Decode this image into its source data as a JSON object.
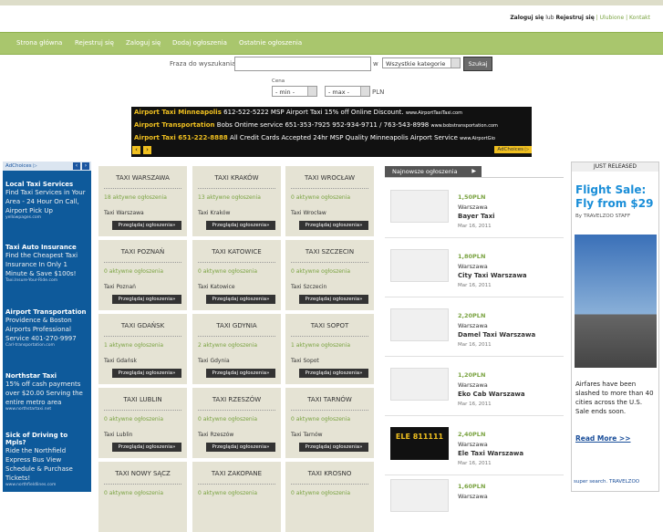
{
  "header": {
    "login_label": "Zaloguj się",
    "or": "lub",
    "register_label": "Rejestruj się",
    "favourites": "Ulubione",
    "contact": "Kontakt"
  },
  "nav": [
    "Strona główna",
    "Rejestruj się",
    "Zaloguj się",
    "Dodaj ogłoszenia",
    "Ostatnie ogłoszenia"
  ],
  "search": {
    "phrase_label": "Fraza do wyszukania",
    "in_label": "w",
    "category": "Wszystkie kategorie",
    "button": "Szukaj",
    "price_label": "Cena",
    "min": "- min -",
    "max": "- max -",
    "currency": "PLN"
  },
  "top_ad": {
    "rows": [
      {
        "title": "Airport Taxi Minneapolis",
        "text": "612-522-5222 MSP Airport Taxi 15% off Online Discount.",
        "url": "www.AirportTaxiTaxi.com"
      },
      {
        "title": "Airport Transportation",
        "text": "Bobs Ontime service 651-353-7925 952-934-9711 / 763-543-8998",
        "url": "www.bobstransportation.com"
      },
      {
        "title": "Airport Taxi 651-222-8888",
        "text": "All Credit Cards Accepted 24hr MSP Quality Minneapolis Airport Service",
        "url": "www.AirportGio"
      }
    ],
    "adchoices": "AdChoices ▷"
  },
  "left_ad": {
    "adchoices": "AdChoices ▷",
    "items": [
      {
        "title": "Local Taxi Services",
        "desc": "Find Taxi Services in Your Area - 24 Hour On Call, Airport Pick Up",
        "url": "yellowpages.com"
      },
      {
        "title": "Taxi Auto Insurance",
        "desc": "Find the Cheapest Taxi Insurance In Only 1 Minute & Save $100s!",
        "url": "Taxi.Insure-Your-Ride.com"
      },
      {
        "title": "Airport Transportation",
        "desc": "Providence & Boston Airports Professional Service 401-270-9997",
        "url": "Carl-transportation.com"
      },
      {
        "title": "Northstar Taxi",
        "desc": "15% off cash payments over $20.00 Serving the entire metro area",
        "url": "www.northstartaxi.net"
      },
      {
        "title": "Sick of Driving to Mpls?",
        "desc": "Ride the Northfield Express Bus View Schedule & Purchase Tickets!",
        "url": "www.northfieldlines.com"
      }
    ]
  },
  "categories": [
    {
      "title": "TAXI WARSZAWA",
      "count": "18 aktywne ogłoszenia",
      "city": "Taxi Warszawa",
      "button": "Przeglądaj ogłoszenia»"
    },
    {
      "title": "TAXI KRAKÓW",
      "count": "13 aktywne ogłoszenia",
      "city": "Taxi Kraków",
      "button": "Przeglądaj ogłoszenia»"
    },
    {
      "title": "TAXI WROCŁAW",
      "count": "0 aktywne ogłoszenia",
      "city": "Taxi Wrocław",
      "button": "Przeglądaj ogłoszenia»"
    },
    {
      "title": "TAXI POZNAŃ",
      "count": "0 aktywne ogłoszenia",
      "city": "Taxi Poznań",
      "button": "Przeglądaj ogłoszenia»"
    },
    {
      "title": "TAXI KATOWICE",
      "count": "0 aktywne ogłoszenia",
      "city": "Taxi Katowice",
      "button": "Przeglądaj ogłoszenia»"
    },
    {
      "title": "TAXI SZCZECIN",
      "count": "0 aktywne ogłoszenia",
      "city": "Taxi Szczecin",
      "button": "Przeglądaj ogłoszenia»"
    },
    {
      "title": "TAXI GDAŃSK",
      "count": "1 aktywne ogłoszenia",
      "city": "Taxi Gdańsk",
      "button": "Przeglądaj ogłoszenia»"
    },
    {
      "title": "TAXI GDYNIA",
      "count": "2 aktywne ogłoszenia",
      "city": "Taxi Gdynia",
      "button": "Przeglądaj ogłoszenia»"
    },
    {
      "title": "TAXI SOPOT",
      "count": "1 aktywne ogłoszenia",
      "city": "Taxi Sopot",
      "button": "Przeglądaj ogłoszenia»"
    },
    {
      "title": "TAXI LUBLIN",
      "count": "0 aktywne ogłoszenia",
      "city": "Taxi Lublin",
      "button": "Przeglądaj ogłoszenia»"
    },
    {
      "title": "TAXI RZESZÓW",
      "count": "0 aktywne ogłoszenia",
      "city": "Taxi Rzeszów",
      "button": "Przeglądaj ogłoszenia»"
    },
    {
      "title": "TAXI TARNÓW",
      "count": "0 aktywne ogłoszenia",
      "city": "Taxi Tarnów",
      "button": "Przeglądaj ogłoszenia»"
    },
    {
      "title": "TAXI NOWY SĄCZ",
      "count": "0 aktywne ogłoszenia",
      "city": "",
      "button": ""
    },
    {
      "title": "TAXI ZAKOPANE",
      "count": "0 aktywne ogłoszenia",
      "city": "",
      "button": ""
    },
    {
      "title": "TAXI KROSNO",
      "count": "0 aktywne ogłoszenia",
      "city": "",
      "button": ""
    }
  ],
  "latest": {
    "header": "Najnowsze ogłoszenia",
    "items": [
      {
        "price": "1,50PLN",
        "city": "Warszawa",
        "name": "Bayer Taxi",
        "date": "Mar 16, 2011"
      },
      {
        "price": "1,80PLN",
        "city": "Warszawa",
        "name": "City Taxi Warszawa",
        "date": "Mar 16, 2011"
      },
      {
        "price": "2,20PLN",
        "city": "Warszawa",
        "name": "Damel Taxi Warszawa",
        "date": "Mar 16, 2011"
      },
      {
        "price": "1,20PLN",
        "city": "Warszawa",
        "name": "Eko Cab Warszawa",
        "date": "Mar 16, 2011"
      },
      {
        "price": "2,40PLN",
        "city": "Warszawa",
        "name": "Ele Taxi Warszawa",
        "date": "Mar 16, 2011",
        "logo_text": "ELE 811111"
      },
      {
        "price": "1,60PLN",
        "city": "Warszawa",
        "name": "",
        "date": ""
      }
    ]
  },
  "right_ad": {
    "just_released": "JUST RELEASED",
    "headline": "Flight Sale: Fly from $29",
    "by": "By TRAVELZOO STAFF",
    "desc": "Airfares have been slashed to more than 40 cities across the U.S. Sale ends soon.",
    "more": "Read More >>",
    "logos": "super search.   TRAVELZOO"
  }
}
